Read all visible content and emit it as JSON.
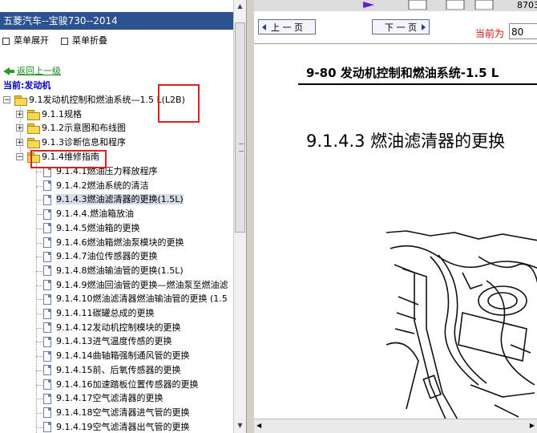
{
  "left_panel": {
    "title": "五菱汽车--宝骏730--2014",
    "menu": {
      "expand": "菜单展开",
      "collapse": "菜单折叠"
    },
    "back": "返回上一级",
    "current": "当前:发动机",
    "tree": {
      "root": "9.1发动机控制和燃油系统—1.5 L(L2B)",
      "nodes": [
        "9.1.1规格",
        "9.1.2示意图和布线图",
        "9.1.3诊断信息和程序",
        "9.1.4维修指南"
      ],
      "items": [
        "9.1.4.1燃油压力释放程序",
        "9.1.4.2燃油系统的清洁",
        "9.1.4.3燃油滤清器的更换(1.5L)",
        "9.1.4.4.燃油箱放油",
        "9.1.4.5燃油箱的更换",
        "9.1.4.6燃油箱燃油泵模块的更换",
        "9.1.4.7油位传感器的更换",
        "9.1.4.8燃油输油管的更换(1.5L)",
        "9.1.4.9燃油回油管的更换—燃油泵至燃油滤",
        "9.1.4.10燃油滤清器燃油输油管的更换 (1.5",
        "9.1.4.11碳罐总成的更换",
        "9.1.4.12发动机控制模块的更换",
        "9.1.4.13进气温度传感的更换",
        "9.1.4.14曲轴箱强制通风管的更换",
        "9.1.4.15前、后氧传感器的更换",
        "9.1.4.16加速踏板位置传感器的更换",
        "9.1.4.17空气滤清器的更换",
        "9.1.4.18空气滤清器进气管的更换",
        "9.1.4.19空气滤清器出气管的更换"
      ]
    }
  },
  "right_panel": {
    "top_number": "8703",
    "prev": "上 一 页",
    "next": "下 一 页",
    "current_label": "当前为",
    "current_value": "80",
    "page_header": "9-80 发动机控制和燃油系统-1.5 L",
    "section_title": "9.1.4.3 燃油滤清器的更换"
  },
  "colors": {
    "title_bg": "#2c5290",
    "highlight": "#e02020",
    "link_green": "#1a8a1a"
  }
}
